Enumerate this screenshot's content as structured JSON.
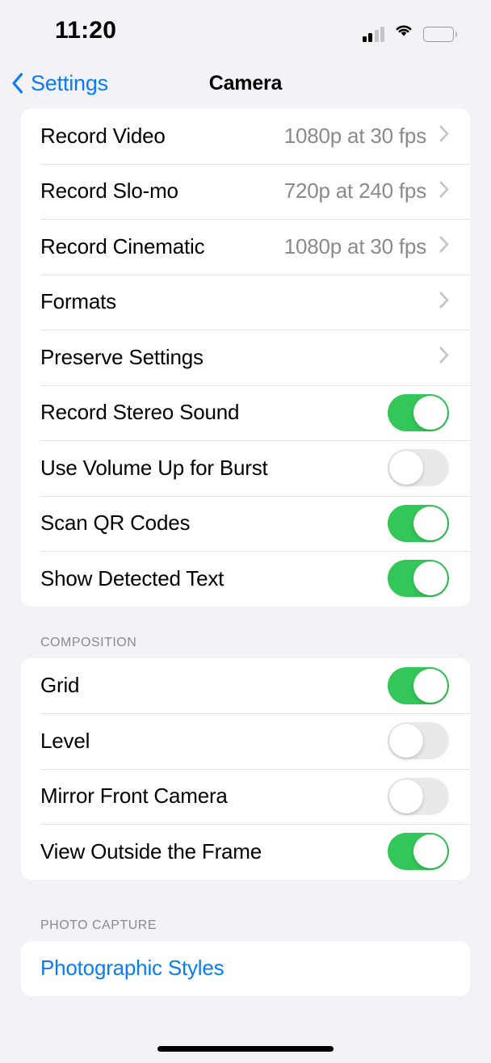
{
  "status_bar": {
    "time": "11:20",
    "cellular_icon": "cellular-signal-icon",
    "wifi_icon": "wifi-icon",
    "battery_icon": "battery-icon"
  },
  "nav": {
    "back_label": "Settings",
    "back_icon": "chevron-left-icon",
    "title": "Camera"
  },
  "colors": {
    "accent_blue": "#0A7AFF",
    "toggle_on_green": "#32C758",
    "toggle_off_gray": "#E9E9EA",
    "page_background": "#F2F2F7",
    "card_background": "#FFFFFF",
    "secondary_text": "#8A8A8E"
  },
  "sections": [
    {
      "header": "",
      "rows": [
        {
          "label": "Record Video",
          "type": "disclosure",
          "value": "1080p at 30 fps"
        },
        {
          "label": "Record Slo-mo",
          "type": "disclosure",
          "value": "720p at 240 fps"
        },
        {
          "label": "Record Cinematic",
          "type": "disclosure",
          "value": "1080p at 30 fps"
        },
        {
          "label": "Formats",
          "type": "disclosure",
          "value": ""
        },
        {
          "label": "Preserve Settings",
          "type": "disclosure",
          "value": ""
        },
        {
          "label": "Record Stereo Sound",
          "type": "toggle",
          "on": true
        },
        {
          "label": "Use Volume Up for Burst",
          "type": "toggle",
          "on": false
        },
        {
          "label": "Scan QR Codes",
          "type": "toggle",
          "on": true
        },
        {
          "label": "Show Detected Text",
          "type": "toggle",
          "on": true
        }
      ]
    },
    {
      "header": "COMPOSITION",
      "rows": [
        {
          "label": "Grid",
          "type": "toggle",
          "on": true
        },
        {
          "label": "Level",
          "type": "toggle",
          "on": false
        },
        {
          "label": "Mirror Front Camera",
          "type": "toggle",
          "on": false
        },
        {
          "label": "View Outside the Frame",
          "type": "toggle",
          "on": true
        }
      ]
    },
    {
      "header": "PHOTO CAPTURE",
      "rows": [
        {
          "label": "Photographic Styles",
          "type": "link"
        }
      ]
    }
  ]
}
